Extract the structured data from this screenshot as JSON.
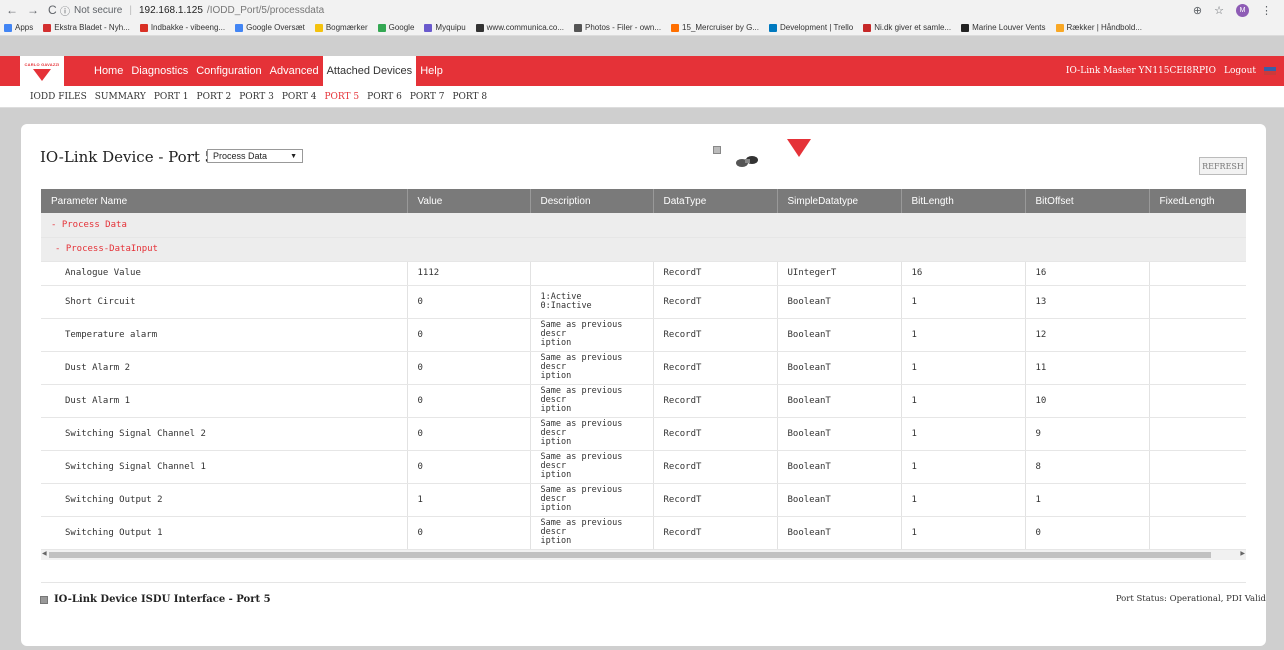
{
  "browser": {
    "security": "Not secure",
    "host": "192.168.1.125",
    "path": "/IODD_Port/5/processdata",
    "avatar": "M",
    "bookmarks": [
      {
        "label": "Apps",
        "color": "#4285f4"
      },
      {
        "label": "Ekstra Bladet - Nyh...",
        "color": "#d32f2f"
      },
      {
        "label": "Indbakke - vibeeng...",
        "color": "#d93025"
      },
      {
        "label": "Google Oversæt",
        "color": "#4285f4"
      },
      {
        "label": "Bogmærker",
        "color": "#f4c20d"
      },
      {
        "label": "Google",
        "color": "#34a853"
      },
      {
        "label": "Myquipu",
        "color": "#6a5acd"
      },
      {
        "label": "www.communica.co...",
        "color": "#333333"
      },
      {
        "label": "Photos - Filer - own...",
        "color": "#555555"
      },
      {
        "label": "15_Mercruiser by G...",
        "color": "#ff6f00"
      },
      {
        "label": "Development | Trello",
        "color": "#0079bf"
      },
      {
        "label": "Ni.dk giver et samle...",
        "color": "#c62828"
      },
      {
        "label": "Marine Louver Vents",
        "color": "#222222"
      },
      {
        "label": "Rækker | Håndbold...",
        "color": "#f9a825"
      }
    ]
  },
  "header": {
    "brand": "CARLO GAVAZZI",
    "nav": [
      "Home",
      "Diagnostics",
      "Configuration",
      "Advanced",
      "Attached Devices",
      "Help"
    ],
    "active_nav": "Attached Devices",
    "device_name": "IO-Link Master YN115CEI8RPIO",
    "logout": "Logout"
  },
  "subnav": {
    "items": [
      "IODD FILES",
      "SUMMARY",
      "PORT 1",
      "PORT 2",
      "PORT 3",
      "PORT 4",
      "PORT 5",
      "PORT 6",
      "PORT 7",
      "PORT 8"
    ],
    "active": "PORT 5"
  },
  "panel": {
    "title": "IO-Link Device - Port 5",
    "view_select": "Process Data",
    "refresh_label": "REFRESH",
    "columns": [
      "Parameter Name",
      "Value",
      "Description",
      "DataType",
      "SimpleDatatype",
      "BitLength",
      "BitOffset",
      "FixedLength"
    ],
    "group_1": "- Process Data",
    "group_2": "- Process-DataInput",
    "rows": [
      {
        "name": "Analogue Value",
        "value": "1112",
        "desc": "",
        "type": "RecordT",
        "simple": "UIntegerT",
        "bitlen": "16",
        "bitoff": "16",
        "fixed": ""
      },
      {
        "name": "Short Circuit",
        "value": "0",
        "desc": "1:Active\n0:Inactive",
        "type": "RecordT",
        "simple": "BooleanT",
        "bitlen": "1",
        "bitoff": "13",
        "fixed": ""
      },
      {
        "name": "Temperature alarm",
        "value": "0",
        "desc": "Same as previous descr\niption",
        "type": "RecordT",
        "simple": "BooleanT",
        "bitlen": "1",
        "bitoff": "12",
        "fixed": ""
      },
      {
        "name": "Dust Alarm 2",
        "value": "0",
        "desc": "Same as previous descr\niption",
        "type": "RecordT",
        "simple": "BooleanT",
        "bitlen": "1",
        "bitoff": "11",
        "fixed": ""
      },
      {
        "name": "Dust Alarm 1",
        "value": "0",
        "desc": "Same as previous descr\niption",
        "type": "RecordT",
        "simple": "BooleanT",
        "bitlen": "1",
        "bitoff": "10",
        "fixed": ""
      },
      {
        "name": "Switching Signal Channel 2",
        "value": "0",
        "desc": "Same as previous descr\niption",
        "type": "RecordT",
        "simple": "BooleanT",
        "bitlen": "1",
        "bitoff": "9",
        "fixed": ""
      },
      {
        "name": "Switching Signal Channel 1",
        "value": "0",
        "desc": "Same as previous descr\niption",
        "type": "RecordT",
        "simple": "BooleanT",
        "bitlen": "1",
        "bitoff": "8",
        "fixed": ""
      },
      {
        "name": "Switching Output 2",
        "value": "1",
        "desc": "Same as previous descr\niption",
        "type": "RecordT",
        "simple": "BooleanT",
        "bitlen": "1",
        "bitoff": "1",
        "fixed": ""
      },
      {
        "name": "Switching Output 1",
        "value": "0",
        "desc": "Same as previous descr\niption",
        "type": "RecordT",
        "simple": "BooleanT",
        "bitlen": "1",
        "bitoff": "0",
        "fixed": ""
      }
    ],
    "isdu_title": "IO-Link Device ISDU Interface - Port 5",
    "port_status": "Port Status: Operational, PDI Valid"
  },
  "colors": {
    "brand_red": "#e53238",
    "header_gray": "#7a7a7a"
  }
}
